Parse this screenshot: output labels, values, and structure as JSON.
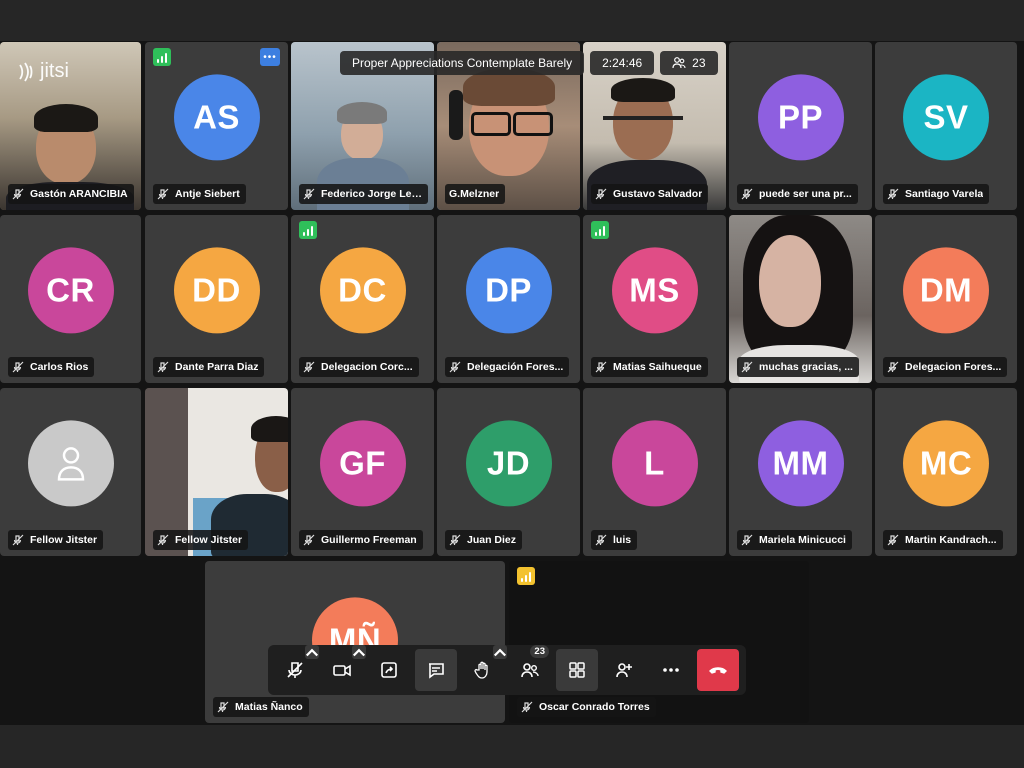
{
  "meeting": {
    "title": "Proper Appreciations Contemplate Barely",
    "timer": "2:24:46",
    "participant_count": "23",
    "logo": "jitsi"
  },
  "colors": {
    "accent_blue": "#3d7fe0",
    "hangup_red": "#e0394a",
    "good_connection": "#2fbf5a",
    "weak_connection": "#f3c22f"
  },
  "tiles": [
    {
      "name": "Gastón ARANCIBIA",
      "type": "video"
    },
    {
      "name": "Antje Siebert",
      "initials": "AS",
      "color": "#4a86e8"
    },
    {
      "name": "Federico Jorge Letou...",
      "type": "video"
    },
    {
      "name": "G.Melzner",
      "type": "video"
    },
    {
      "name": "Gustavo Salvador",
      "type": "video"
    },
    {
      "name": "puede ser una pr...",
      "initials": "PP",
      "color": "#8e5fe0"
    },
    {
      "name": "Santiago Varela",
      "initials": "SV",
      "color": "#1bb5c4"
    },
    {
      "name": "Carlos Rios",
      "initials": "CR",
      "color": "#c9479b"
    },
    {
      "name": "Dante Parra Diaz",
      "initials": "DD",
      "color": "#f5a742"
    },
    {
      "name": "Delegacion Corc...",
      "initials": "DC",
      "color": "#f5a742"
    },
    {
      "name": "Delegación Fores...",
      "initials": "DP",
      "color": "#4a86e8"
    },
    {
      "name": "Matias Saihueque",
      "initials": "MS",
      "color": "#e04d86"
    },
    {
      "name": "muchas gracias, ...",
      "type": "video"
    },
    {
      "name": "Delegacion Fores...",
      "initials": "DM",
      "color": "#f37c5a"
    },
    {
      "name": "Fellow Jitster",
      "type": "anon"
    },
    {
      "name": "Fellow Jitster",
      "type": "video"
    },
    {
      "name": "Guillermo Freeman",
      "initials": "GF",
      "color": "#c9479b"
    },
    {
      "name": "Juan Diez",
      "initials": "JD",
      "color": "#2e9e6a"
    },
    {
      "name": "luis",
      "initials": "L",
      "color": "#c9479b"
    },
    {
      "name": "Mariela Minicucci",
      "initials": "MM",
      "color": "#8e5fe0"
    },
    {
      "name": "Martin Kandrach...",
      "initials": "MC",
      "color": "#f5a742"
    },
    {
      "name": "Matias Ñanco",
      "initials": "MÑ",
      "color": "#f37c5a"
    },
    {
      "name": "Oscar Conrado Torres",
      "type": "blank"
    }
  ],
  "toolbar": {
    "buttons": [
      "microphone-off",
      "camera",
      "screen-share",
      "chat",
      "raise-hand",
      "participants",
      "tile-view",
      "invite",
      "more",
      "hang-up"
    ],
    "participants_badge": "23"
  }
}
